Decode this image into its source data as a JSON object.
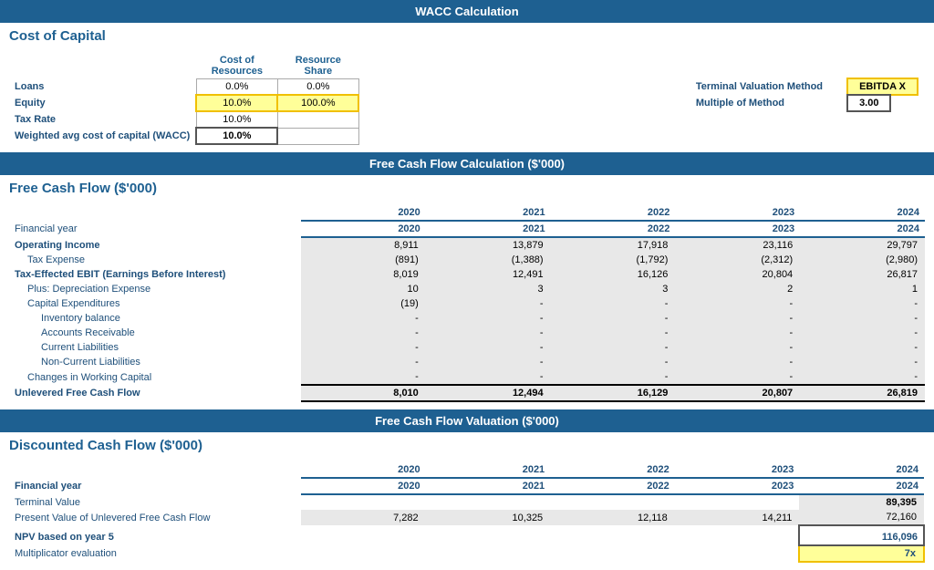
{
  "page": {
    "title": "WACC Calculation"
  },
  "wacc": {
    "section_title": "Cost of Capital",
    "col1_header": "Cost of Resources",
    "col2_header": "Resource Share",
    "rows": [
      {
        "label": "Loans",
        "cost": "0.0%",
        "share": "0.0%"
      },
      {
        "label": "Equity",
        "cost": "10.0%",
        "share": "100.0%"
      },
      {
        "label": "Tax Rate",
        "cost": "10.0%",
        "share": ""
      },
      {
        "label": "Weighted avg cost of capital (WACC)",
        "cost": "10.0%",
        "share": ""
      }
    ],
    "terminal_method_label": "Terminal Valuation Method",
    "terminal_method_value": "EBITDA X",
    "multiple_label": "Multiple of Method",
    "multiple_value": "3.00"
  },
  "fcf": {
    "section_header": "Free Cash Flow Calculation ($'000)",
    "section_title": "Free Cash Flow ($'000)",
    "years": [
      "2020",
      "2021",
      "2022",
      "2023",
      "2024"
    ],
    "rows": [
      {
        "label": "Financial year",
        "type": "header",
        "indent": 0,
        "values": [
          "",
          "",
          "",
          "",
          ""
        ]
      },
      {
        "label": "Operating Income",
        "type": "bold",
        "indent": 0,
        "values": [
          "8,911",
          "13,879",
          "17,918",
          "23,116",
          "29,797"
        ]
      },
      {
        "label": "Tax Expense",
        "type": "normal",
        "indent": 1,
        "values": [
          "(891)",
          "(1,388)",
          "(1,792)",
          "(2,312)",
          "(2,980)"
        ]
      },
      {
        "label": "Tax-Effected EBIT (Earnings Before Interest)",
        "type": "bold",
        "indent": 0,
        "values": [
          "8,019",
          "12,491",
          "16,126",
          "20,804",
          "26,817"
        ]
      },
      {
        "label": "Plus: Depreciation Expense",
        "type": "normal",
        "indent": 1,
        "values": [
          "10",
          "3",
          "3",
          "2",
          "1"
        ]
      },
      {
        "label": "Capital Expenditures",
        "type": "normal",
        "indent": 1,
        "values": [
          "(19)",
          "-",
          "-",
          "-",
          "-"
        ]
      },
      {
        "label": "Inventory balance",
        "type": "normal",
        "indent": 2,
        "values": [
          "-",
          "-",
          "-",
          "-",
          "-"
        ]
      },
      {
        "label": "Accounts Receivable",
        "type": "normal",
        "indent": 2,
        "values": [
          "-",
          "-",
          "-",
          "-",
          "-"
        ]
      },
      {
        "label": "Current Liabilities",
        "type": "normal",
        "indent": 2,
        "values": [
          "-",
          "-",
          "-",
          "-",
          "-"
        ]
      },
      {
        "label": "Non-Current Liabilities",
        "type": "normal",
        "indent": 2,
        "values": [
          "-",
          "-",
          "-",
          "-",
          "-"
        ]
      },
      {
        "label": "Changes in Working Capital",
        "type": "normal",
        "indent": 1,
        "values": [
          "-",
          "-",
          "-",
          "-",
          "-"
        ]
      },
      {
        "label": "Unlevered Free Cash Flow",
        "type": "total",
        "indent": 0,
        "values": [
          "8,010",
          "12,494",
          "16,129",
          "20,807",
          "26,819"
        ]
      }
    ]
  },
  "dcf": {
    "section_header": "Free Cash Flow Valuation ($'000)",
    "section_title": "Discounted Cash Flow ($'000)",
    "years": [
      "2020",
      "2021",
      "2022",
      "2023",
      "2024"
    ],
    "rows": [
      {
        "label": "Financial year",
        "type": "header",
        "values": [
          "",
          "",
          "",
          "",
          ""
        ]
      },
      {
        "label": "Terminal Value",
        "type": "normal",
        "values": [
          "",
          "",
          "",
          "",
          "89,395"
        ]
      },
      {
        "label": "Present Value of Unlevered Free Cash Flow",
        "type": "normal",
        "values": [
          "7,282",
          "10,325",
          "12,118",
          "14,211",
          "72,160"
        ]
      }
    ],
    "npv_label": "NPV based on year 5",
    "npv_value": "116,096",
    "mult_label": "Multiplicator evaluation",
    "mult_value": "7x"
  }
}
